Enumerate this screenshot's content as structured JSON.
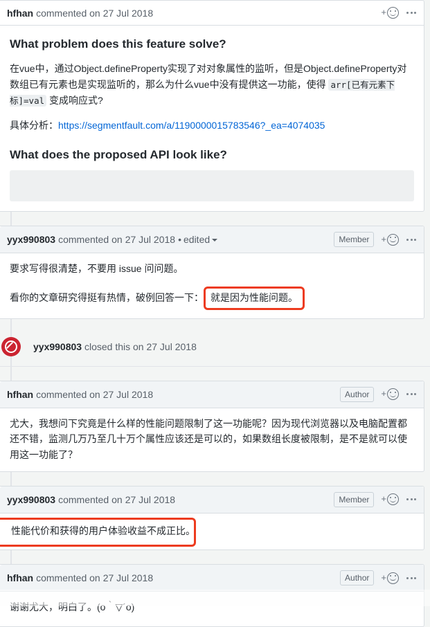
{
  "timeline": [
    {
      "type": "comment",
      "author": "hfhan",
      "action": "commented on",
      "date": "27 Jul 2018",
      "edited": null,
      "badge": null,
      "reaction_plus": "+",
      "reaction_icon": "smiley-icon",
      "menu_icon": "kebab-menu-icon",
      "heading_1": "What problem does this feature solve?",
      "para_1_part_a": "在vue中，通过Object.defineProperty实现了对对象属性的监听，但是Object.defineProperty对数组已有元素也是实现监听的，那么为什么vue中没有提供这一功能，使得 ",
      "para_1_code": "arr[已有元素下标]=val",
      "para_1_part_b": " 变成响应式?",
      "para_2_label": "具体分析：",
      "para_2_link": "https://segmentfault.com/a/1190000015783546?_ea=4074035",
      "heading_2": "What does the proposed API look like?",
      "codeblock": ""
    },
    {
      "type": "comment",
      "author": "yyx990803",
      "action": "commented on",
      "date": "27 Jul 2018",
      "edited": "edited",
      "edited_separator": "•",
      "badge": "Member",
      "reaction_plus": "+",
      "reaction_icon": "smiley-icon",
      "menu_icon": "kebab-menu-icon",
      "para_1": "要求写得很清楚，不要用 issue 问问题。",
      "para_2_prefix": "看你的文章研究得挺有热情，破例回答一下：",
      "para_2_highlighted": "就是因为性能问题。"
    },
    {
      "type": "event",
      "icon": "closed-issue-icon",
      "actor": "yyx990803",
      "text": "closed this on",
      "date": "27 Jul 2018"
    },
    {
      "type": "comment",
      "author": "hfhan",
      "action": "commented on",
      "date": "27 Jul 2018",
      "edited": null,
      "badge": "Author",
      "reaction_plus": "+",
      "reaction_icon": "smiley-icon",
      "menu_icon": "kebab-menu-icon",
      "para_1": "尤大，我想问下究竟是什么样的性能问题限制了这一功能呢？因为现代浏览器以及电脑配置都还不错，监测几万乃至几十万个属性应该还是可以的，如果数组长度被限制，是不是就可以使用这一功能了？"
    },
    {
      "type": "comment",
      "author": "yyx990803",
      "action": "commented on",
      "date": "27 Jul 2018",
      "edited": null,
      "badge": "Member",
      "reaction_plus": "+",
      "reaction_icon": "smiley-icon",
      "menu_icon": "kebab-menu-icon",
      "para_1_highlighted": "性能代价和获得的用户体验收益不成正比。"
    },
    {
      "type": "comment",
      "author": "hfhan",
      "action": "commented on",
      "date": "27 Jul 2018",
      "edited": null,
      "badge": "Author",
      "reaction_plus": "+",
      "reaction_icon": "smiley-icon",
      "menu_icon": "kebab-menu-icon",
      "para_1": "谢谢尤大，明白了。(o｀▽´o)"
    }
  ],
  "colors": {
    "link": "#0366d6",
    "annotation_red": "#ed3b1f",
    "closed_red": "#cb2431",
    "header_bg": "#f1f4f6",
    "page_bg": "#f3f5f4",
    "border": "#d9dee2"
  }
}
